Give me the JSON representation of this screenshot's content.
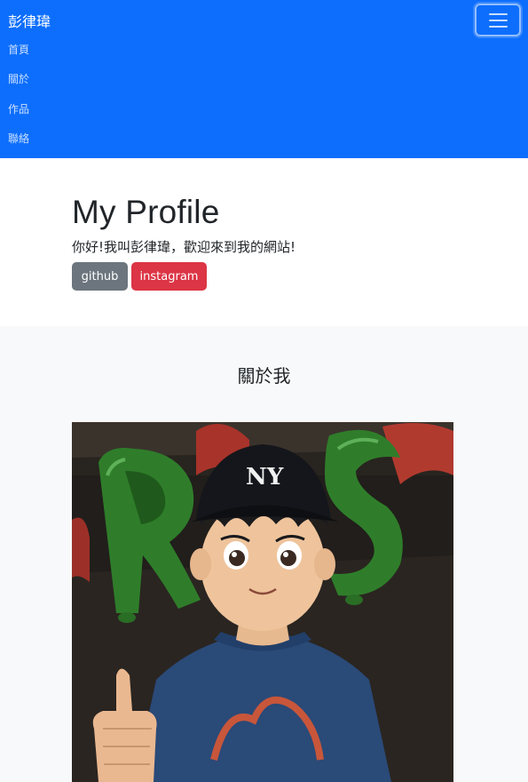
{
  "navbar": {
    "brand": "彭律瑋",
    "toggler_icon": "hamburger-menu-icon",
    "items": [
      {
        "label": "首頁"
      },
      {
        "label": "關於"
      },
      {
        "label": "作品"
      },
      {
        "label": "聯絡"
      }
    ],
    "colors": {
      "background": "#0d6efd"
    }
  },
  "hero": {
    "title": "My Profile",
    "subtitle": "你好!我叫彭律瑋，歡迎來到我的網站!",
    "buttons": [
      {
        "label": "github",
        "color": "#6c757d"
      },
      {
        "label": "instagram",
        "color": "#dc3545"
      }
    ]
  },
  "about": {
    "title": "關於我",
    "photo_subject": "anime-style boy in NY cap giving thumbs up before green and red letter balloons"
  }
}
